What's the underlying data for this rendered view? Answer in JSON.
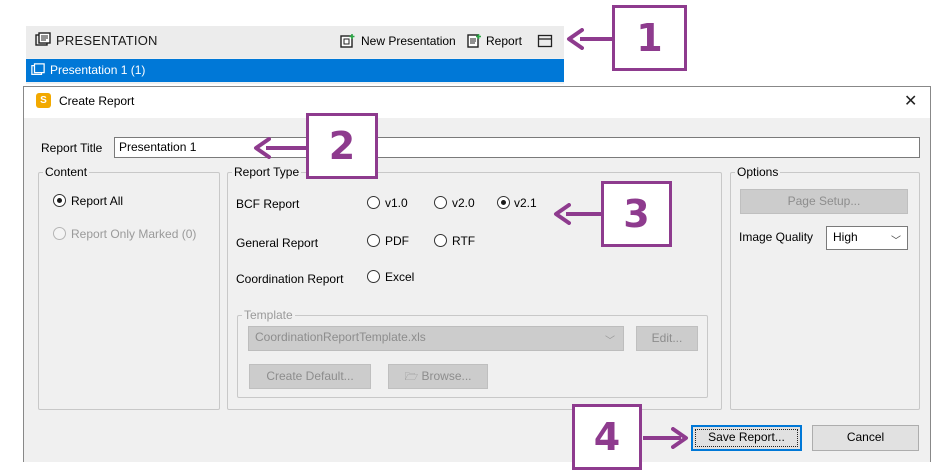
{
  "panel": {
    "title": "PRESENTATION",
    "actions": {
      "new_presentation": "New Presentation",
      "report": "Report"
    },
    "selected_item": "Presentation 1 (1)"
  },
  "dialog": {
    "title": "Create Report",
    "report_title_label": "Report Title",
    "report_title_value": "Presentation 1",
    "content": {
      "legend": "Content",
      "report_all": "Report All",
      "report_only_marked": "Report Only Marked (0)"
    },
    "report_type": {
      "legend": "Report Type",
      "bcf_label": "BCF Report",
      "bcf_options": [
        "v1.0",
        "v2.0",
        "v2.1"
      ],
      "bcf_selected": "v2.1",
      "general_label": "General Report",
      "general_options": [
        "PDF",
        "RTF"
      ],
      "coordination_label": "Coordination Report",
      "coordination_option": "Excel",
      "template": {
        "legend": "Template",
        "value": "CoordinationReportTemplate.xls",
        "edit": "Edit...",
        "create_default": "Create Default...",
        "browse": "Browse..."
      }
    },
    "options": {
      "legend": "Options",
      "page_setup": "Page Setup...",
      "image_quality_label": "Image Quality",
      "image_quality_value": "High"
    },
    "buttons": {
      "save": "Save Report...",
      "cancel": "Cancel"
    }
  },
  "callouts": [
    "1",
    "2",
    "3",
    "4"
  ],
  "colors": {
    "accent": "#0078d7",
    "callout": "#8e3b8e",
    "dialog_bg": "#f0f0f0"
  }
}
